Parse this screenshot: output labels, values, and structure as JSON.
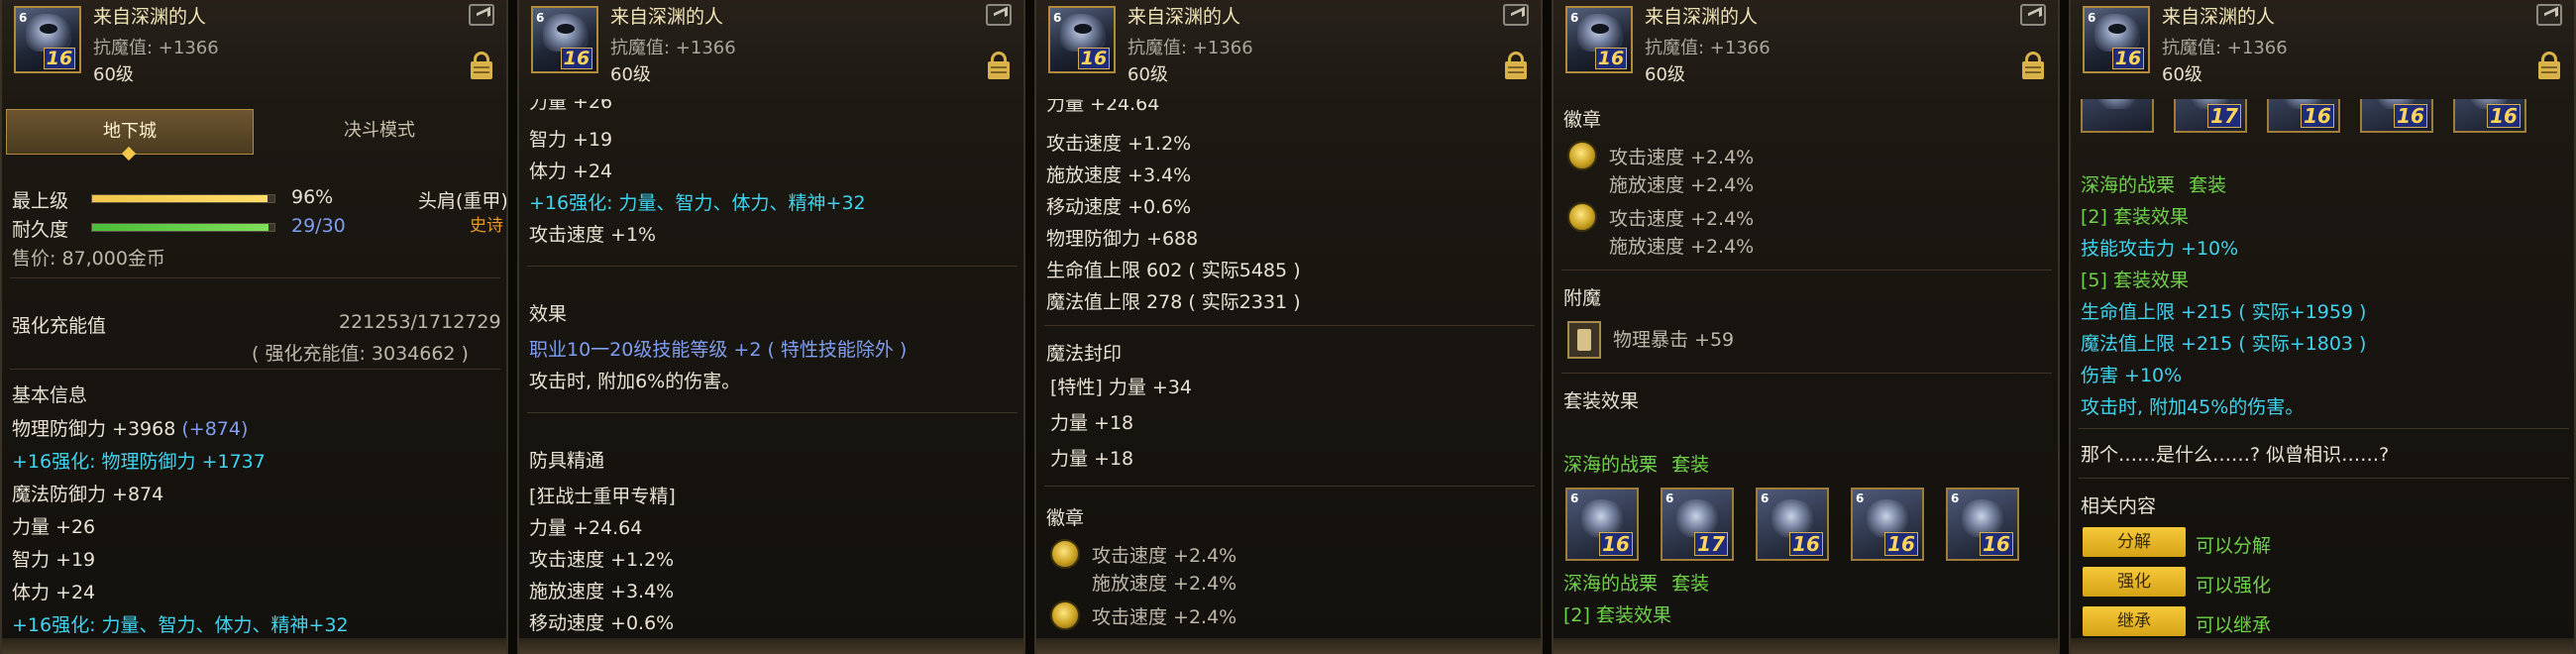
{
  "header": {
    "item_name": "来自深渊的人",
    "resist": "抗魔值: +1366",
    "level": "60级",
    "icon_level": "16",
    "icon_grade": "6"
  },
  "colors": {
    "cyan": "#3fd3ee",
    "blue": "#7f9ef0",
    "green": "#6fd04a",
    "orange": "#e79a2b",
    "gold": "#d9b24a"
  },
  "panel1": {
    "tab_dungeon": "地下城",
    "tab_pvp": "决斗模式",
    "grade_label": "最上级",
    "grade_value": "96%",
    "grade_fraction": 0.96,
    "durability_label": "耐久度",
    "durability_value": "29/30",
    "durability_fraction": 0.97,
    "slot": "头肩(重甲)",
    "rarity": "史诗",
    "price": "售价: 87,000金币",
    "amp_label": "强化充能值",
    "amp_value": "221253/1712729",
    "amp_sub": "( 强化充能值: 3034662 )",
    "basic_title": "基本信息",
    "phys_def": "物理防御力 +3968",
    "phys_def_bonus": "(+874)",
    "enhance_def": "+16强化: 物理防御力 +1737",
    "magic_def": "魔法防御力 +874",
    "str": "力量 +26",
    "int": "智力 +19",
    "vit": "体力 +24",
    "enhance_stats": "+16强化: 力量、智力、体力、精神+32"
  },
  "panel2": {
    "top_partial": "力量 +26",
    "int": "智力 +19",
    "vit": "体力 +24",
    "enhance_stats": "+16强化: 力量、智力、体力、精神+32",
    "atk_speed": "攻击速度 +1%",
    "effect_title": "效果",
    "effect_skill": "职业10一20级技能等级 +2 ( 特性技能除外 )",
    "effect_damage": "攻击时, 附加6%的伤害。",
    "mastery_title": "防具精通",
    "mastery_name": "[狂战士重甲专精]",
    "str": "力量 +24.64",
    "atk_speed2": "攻击速度 +1.2%",
    "cast_speed": "施放速度 +3.4%",
    "move_speed": "移动速度 +0.6%"
  },
  "panel3": {
    "top_partial": "力量 +24.64",
    "atk_speed": "攻击速度 +1.2%",
    "cast_speed": "施放速度 +3.4%",
    "move_speed": "移动速度 +0.6%",
    "phys_def": "物理防御力 +688",
    "hp": "生命值上限 602 ( 实际5485 )",
    "mp": "魔法值上限 278 ( 实际2331 )",
    "seal_title": "魔法封印",
    "seal_1": "[特性] 力量 +34",
    "seal_2": "力量 +18",
    "seal_3": "力量 +18",
    "emblem_title": "徽章",
    "emblem_1a": "攻击速度 +2.4%",
    "emblem_1b": "施放速度 +2.4%",
    "emblem_2a": "攻击速度 +2.4%"
  },
  "panel4": {
    "emblem_title": "徽章",
    "emblem_1a": "攻击速度 +2.4%",
    "emblem_1b": "施放速度 +2.4%",
    "emblem_2a": "攻击速度 +2.4%",
    "emblem_2b": "施放速度 +2.4%",
    "enchant_title": "附魔",
    "enchant": "物理暴击 +59",
    "set_title": "套装效果",
    "set_name": "深海的战栗",
    "set_suffix": "套装",
    "set_icons": [
      {
        "level": "16",
        "grade": "6"
      },
      {
        "level": "17",
        "grade": "6"
      },
      {
        "level": "16",
        "grade": "6"
      },
      {
        "level": "16",
        "grade": "6"
      },
      {
        "level": "16",
        "grade": "6"
      }
    ],
    "set_name2": "深海的战栗",
    "set_suffix2": "套装",
    "bonus2": "[2] 套装效果"
  },
  "panel5": {
    "set_icons": [
      {
        "level": "",
        "grade": ""
      },
      {
        "level": "17",
        "grade": ""
      },
      {
        "level": "16",
        "grade": ""
      },
      {
        "level": "16",
        "grade": ""
      },
      {
        "level": "16",
        "grade": ""
      }
    ],
    "set_name": "深海的战栗",
    "set_suffix": "套装",
    "bonus2": "[2] 套装效果",
    "skill_atk": "技能攻击力 +10%",
    "bonus5": "[5] 套装效果",
    "hp": "生命值上限 +215 ( 实际+1959 )",
    "mp": "魔法值上限 +215 ( 实际+1803 )",
    "dmg": "伤害 +10%",
    "extra_dmg": "攻击时, 附加45%的伤害。",
    "flavor": "那个……是什么……? 似曾相识……?",
    "related_title": "相关内容",
    "disassemble_btn": "分解",
    "disassemble_text": "可以分解",
    "enhance_btn": "强化",
    "enhance_text": "可以强化",
    "inherit_btn": "继承",
    "inherit_text": "可以继承"
  }
}
